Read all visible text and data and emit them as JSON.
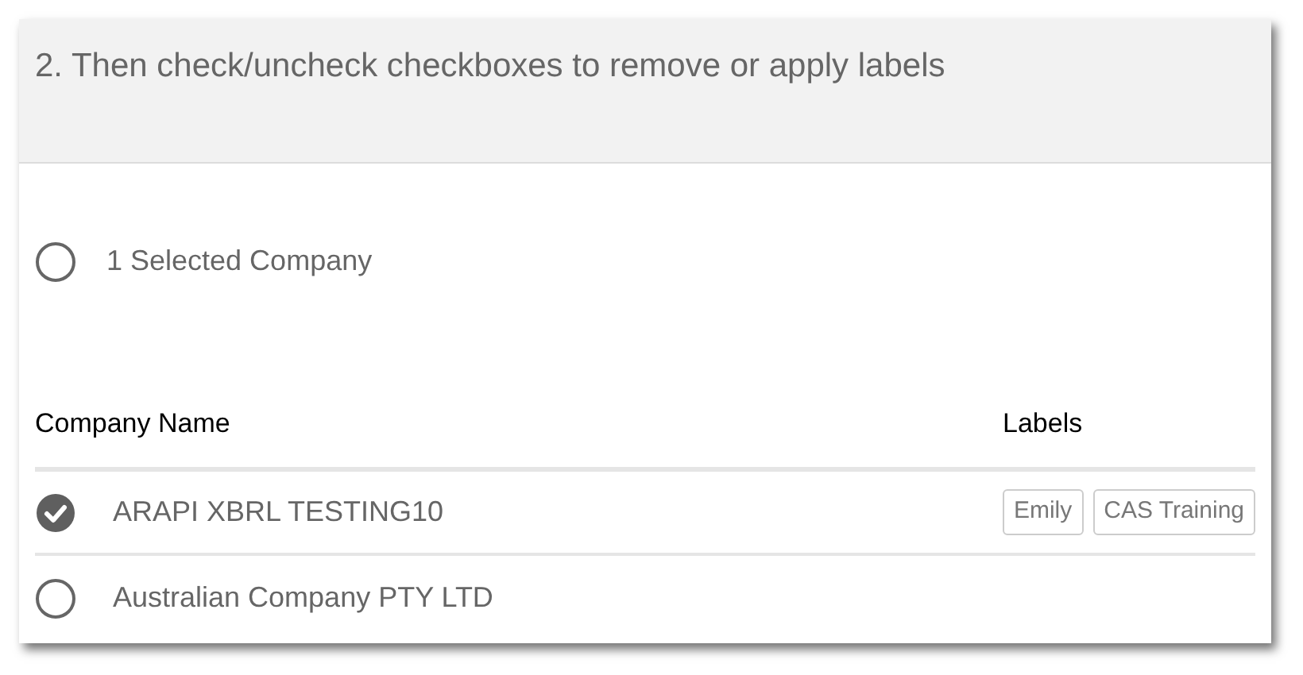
{
  "header": {
    "title": "2. Then check/uncheck checkboxes to remove or apply labels"
  },
  "select_all": {
    "label": "1 Selected Company",
    "checked": false
  },
  "table": {
    "columns": [
      "Company Name",
      "Labels"
    ],
    "rows": [
      {
        "name": "ARAPI XBRL TESTING10",
        "checked": true,
        "labels": [
          "Emily",
          "CAS Training"
        ]
      },
      {
        "name": "Australian Company PTY LTD",
        "checked": false,
        "labels": []
      }
    ]
  }
}
